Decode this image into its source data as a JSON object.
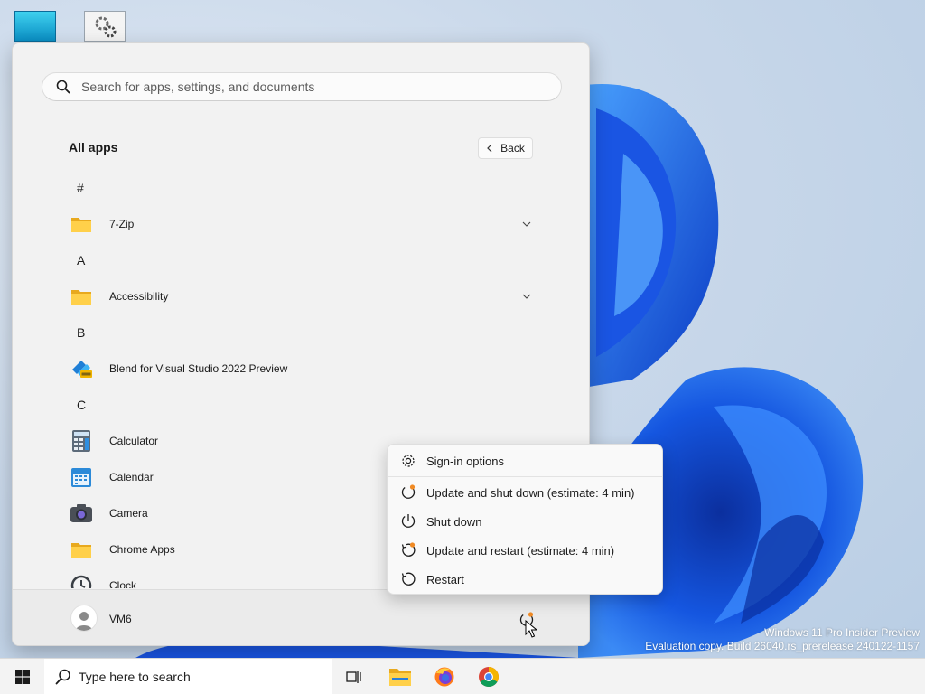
{
  "start_menu": {
    "search": {
      "placeholder": "Search for apps, settings, and documents"
    },
    "all_apps": {
      "title": "All apps",
      "back_label": "Back",
      "items": [
        {
          "type": "letter",
          "label": "#"
        },
        {
          "type": "app",
          "name": "7-Zip",
          "icon": "folder-icon",
          "expandable": true
        },
        {
          "type": "letter",
          "label": "A"
        },
        {
          "type": "app",
          "name": "Accessibility",
          "icon": "folder-icon",
          "expandable": true
        },
        {
          "type": "letter",
          "label": "B"
        },
        {
          "type": "app",
          "name": "Blend for Visual Studio 2022 Preview",
          "icon": "blend-icon",
          "expandable": false
        },
        {
          "type": "letter",
          "label": "C"
        },
        {
          "type": "app",
          "name": "Calculator",
          "icon": "calculator-icon",
          "expandable": false
        },
        {
          "type": "app",
          "name": "Calendar",
          "icon": "calendar-icon",
          "expandable": false
        },
        {
          "type": "app",
          "name": "Camera",
          "icon": "camera-icon",
          "expandable": false
        },
        {
          "type": "app",
          "name": "Chrome Apps",
          "icon": "folder-icon",
          "expandable": true
        },
        {
          "type": "app",
          "name": "Clock",
          "icon": "clock-icon",
          "expandable": false
        }
      ]
    },
    "footer": {
      "username": "VM6",
      "power_icon": "power-update-icon"
    }
  },
  "power_menu": {
    "items": [
      {
        "label": "Sign-in options",
        "icon": "gear-icon"
      },
      {
        "label": "Update and shut down (estimate: 4 min)",
        "icon": "power-update-icon"
      },
      {
        "label": "Shut down",
        "icon": "power-icon"
      },
      {
        "label": "Update and restart (estimate: 4 min)",
        "icon": "restart-update-icon"
      },
      {
        "label": "Restart",
        "icon": "restart-icon"
      }
    ]
  },
  "taskbar": {
    "search_placeholder": "Type here to search",
    "pinned": [
      {
        "name": "Task View",
        "icon": "task-view-icon"
      },
      {
        "name": "File Explorer",
        "icon": "file-explorer-icon"
      },
      {
        "name": "Firefox",
        "icon": "firefox-icon"
      },
      {
        "name": "Chrome",
        "icon": "chrome-icon"
      }
    ]
  },
  "watermark": {
    "line1": "Windows 11 Pro Insider Preview",
    "line2": "Evaluation copy. Build 26040.rs_prerelease.240122-1157"
  },
  "colors": {
    "accent": "#0067c0",
    "update_dot": "#f08a24",
    "wallpaper_blue": "#0a4fd6"
  }
}
